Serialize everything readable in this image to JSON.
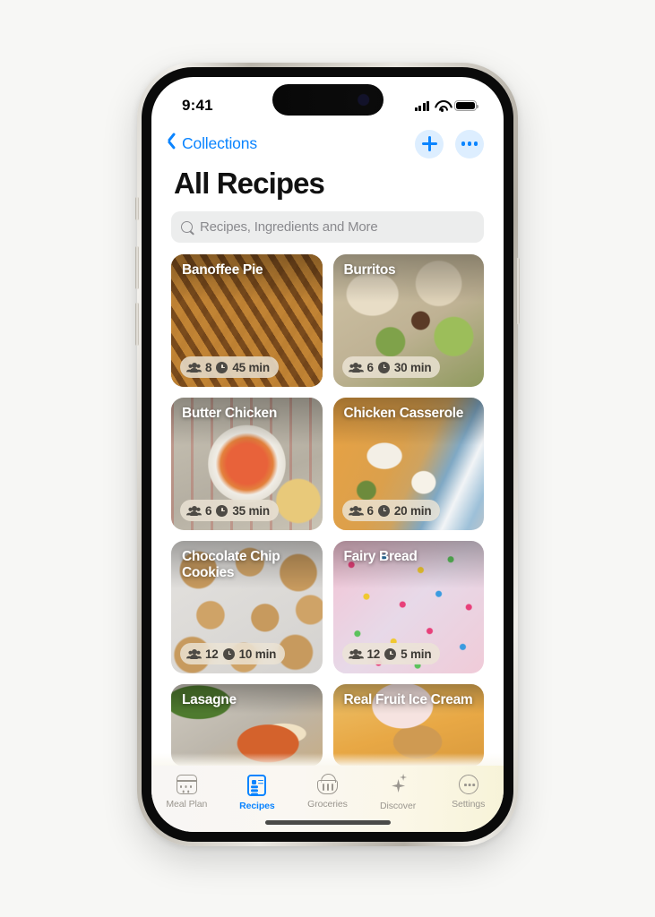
{
  "status_bar": {
    "time": "9:41",
    "icons": [
      "cellular-signal-icon",
      "wifi-icon",
      "battery-icon"
    ]
  },
  "nav": {
    "back_label": "Collections",
    "back_icon": "chevron-left-icon",
    "add_icon": "plus-icon",
    "more_icon": "ellipsis-icon"
  },
  "page_title": "All Recipes",
  "search": {
    "placeholder": "Recipes, Ingredients and More",
    "icon": "search-icon"
  },
  "recipes": [
    {
      "title": "Banoffee Pie",
      "servings": "8",
      "time": "45 min",
      "theme": "ph-banoffee"
    },
    {
      "title": "Burritos",
      "servings": "6",
      "time": "30 min",
      "theme": "ph-burritos"
    },
    {
      "title": "Butter Chicken",
      "servings": "6",
      "time": "35 min",
      "theme": "ph-butter"
    },
    {
      "title": "Chicken Casserole",
      "servings": "6",
      "time": "20 min",
      "theme": "ph-casserole"
    },
    {
      "title": "Chocolate Chip Cookies",
      "servings": "12",
      "time": "10 min",
      "theme": "ph-cookies"
    },
    {
      "title": "Fairy Bread",
      "servings": "12",
      "time": "5 min",
      "theme": "ph-fairy"
    },
    {
      "title": "Lasagne",
      "servings": "",
      "time": "",
      "theme": "ph-lasagne"
    },
    {
      "title": "Real Fruit Ice Cream",
      "servings": "",
      "time": "",
      "theme": "ph-icecream"
    }
  ],
  "tabs": [
    {
      "label": "Meal Plan",
      "icon": "calendar-icon",
      "active": false
    },
    {
      "label": "Recipes",
      "icon": "document-icon",
      "active": true
    },
    {
      "label": "Groceries",
      "icon": "basket-icon",
      "active": false
    },
    {
      "label": "Discover",
      "icon": "sparkle-icon",
      "active": false
    },
    {
      "label": "Settings",
      "icon": "more-circle-icon",
      "active": false
    }
  ],
  "colors": {
    "accent": "#0a84ff",
    "page_background": "#f7f7f5",
    "screen_background": "#ffffff",
    "search_field": "#eceded",
    "tab_inactive": "#9a968f"
  }
}
